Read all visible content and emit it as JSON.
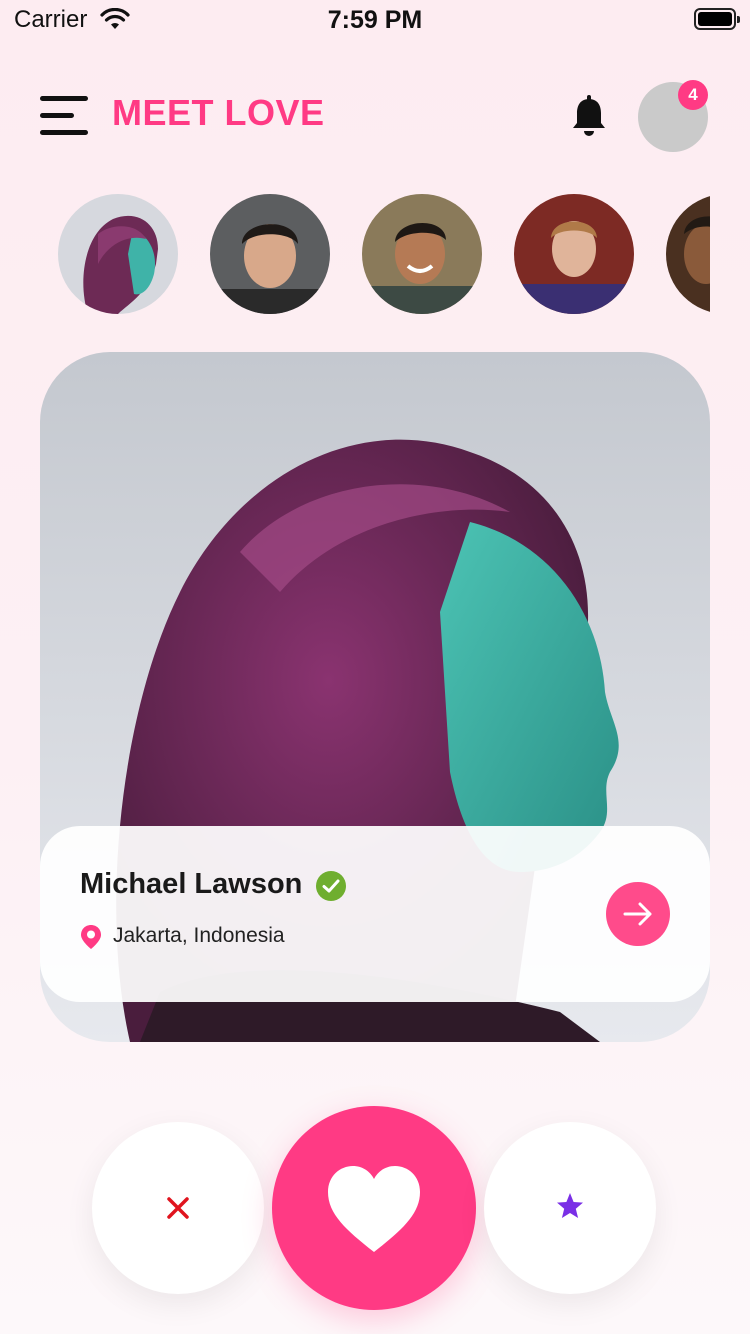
{
  "status_bar": {
    "carrier": "Carrier",
    "time": "7:59 PM"
  },
  "header": {
    "title": "MEET LOVE",
    "notification_count": "4"
  },
  "stories": [
    {
      "name": "story-1"
    },
    {
      "name": "story-2"
    },
    {
      "name": "story-3"
    },
    {
      "name": "story-4"
    },
    {
      "name": "story-5"
    }
  ],
  "profile": {
    "name": "Michael Lawson",
    "location": "Jakarta, Indonesia",
    "verified": true
  },
  "actions": {
    "dislike_icon": "close-icon",
    "like_icon": "heart-icon",
    "superlike_icon": "star-icon"
  },
  "colors": {
    "accent": "#ff3a84",
    "verified": "#6fae2f",
    "dislike": "#e0141e",
    "superlike": "#7a2fe6"
  }
}
